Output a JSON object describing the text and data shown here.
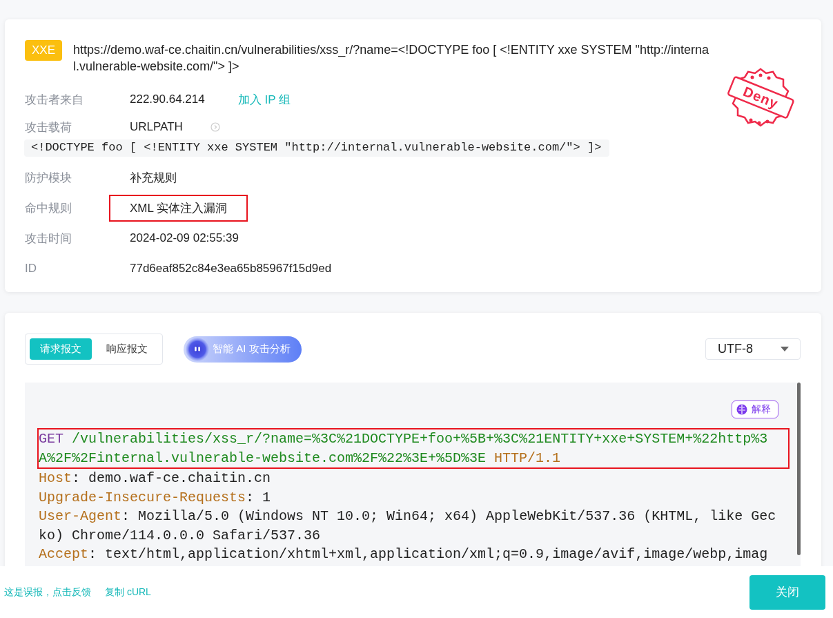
{
  "event": {
    "tag": "XXE",
    "url": "https://demo.waf-ce.chaitin.cn/vulnerabilities/xss_r/?name=<!DOCTYPE foo [ <!ENTITY xxe SYSTEM \"http://internal.vulnerable-website.com/\"> ]>",
    "stamp": "Deny",
    "rows": [
      {
        "kind": "ip",
        "label": "攻击者来自",
        "value": "222.90.64.214",
        "link": "加入 IP 组",
        "highlighted": false
      },
      {
        "kind": "payload",
        "label": "攻击载荷",
        "value": "URLPATH",
        "code": "<!DOCTYPE foo [ <!ENTITY xxe SYSTEM \"http://internal.vulnerable-website.com/\"> ]>",
        "highlighted": false
      },
      {
        "kind": "text",
        "label": "防护模块",
        "value": "补充规则",
        "highlighted": false
      },
      {
        "kind": "text",
        "label": "命中规则",
        "value": "XML 实体注入漏洞",
        "highlighted": true
      },
      {
        "kind": "text",
        "label": "攻击时间",
        "value": "2024-02-09 02:55:39",
        "highlighted": false
      },
      {
        "kind": "text",
        "label": "ID",
        "value": "77d6eaf852c84e3ea65b85967f15d9ed",
        "highlighted": false
      }
    ]
  },
  "message": {
    "tabs": [
      {
        "label": "请求报文",
        "selected": true
      },
      {
        "label": "响应报文",
        "selected": false
      }
    ],
    "ai_button": "智能 AI 攻击分析",
    "encoding": "UTF-8",
    "explain_button": "解释",
    "code_blocks": [
      {
        "highlighted": true,
        "lines": [
          [
            {
              "kind": "method",
              "text": "GET"
            },
            {
              "kind": "path",
              "text": " /vulnerabilities/xss_r/?name=%3C%21DOCTYPE+foo+%5B+%3C%21ENTITY+xxe+SYSTEM+%22http%3"
            }
          ],
          [
            {
              "kind": "path",
              "text": "A%2F%2Finternal.vulnerable-website.com%2F%22%3E+%5D%3E "
            },
            {
              "kind": "version",
              "text": "HTTP/1.1"
            }
          ]
        ]
      },
      {
        "highlighted": false,
        "lines": [
          [
            {
              "kind": "header",
              "text": "Host"
            },
            {
              "kind": "value",
              "text": ": demo.waf-ce.chaitin.cn"
            }
          ],
          [
            {
              "kind": "header",
              "text": "Upgrade-Insecure-Requests"
            },
            {
              "kind": "value",
              "text": ": 1"
            }
          ],
          [
            {
              "kind": "header",
              "text": "User-Agent"
            },
            {
              "kind": "value",
              "text": ": Mozilla/5.0 (Windows NT 10.0; Win64; x64) AppleWebKit/537.36 (KHTML, like Gec"
            }
          ],
          [
            {
              "kind": "value",
              "text": "ko) Chrome/114.0.0.0 Safari/537.36"
            }
          ],
          [
            {
              "kind": "header",
              "text": "Accept"
            },
            {
              "kind": "value",
              "text": ": text/html,application/xhtml+xml,application/xml;q=0.9,image/avif,image/webp,imag"
            }
          ]
        ]
      }
    ]
  },
  "footer": {
    "links": [
      "这是误报，点击反馈",
      "复制 cURL"
    ],
    "close_button": "关闭"
  }
}
